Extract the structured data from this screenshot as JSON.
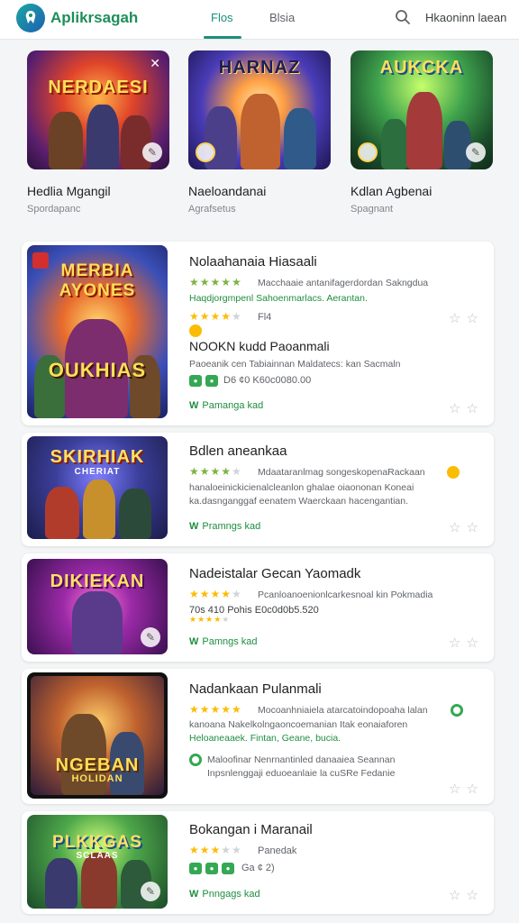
{
  "header": {
    "brand": "Aplikrsagah",
    "tabs": [
      "Flos",
      "Blsia"
    ],
    "active_tab": 0,
    "account": "Hkaoninn laean"
  },
  "icons": {
    "logo": "app-logo-icon",
    "search": "search-icon",
    "favorite": "star-outline-icon",
    "install": "check-badge-icon"
  },
  "colors": {
    "accent": "#1a8f7c",
    "brand": "#1e8e5a",
    "rating": "#7cb342"
  },
  "featured": [
    {
      "art_title": "NERDAESI",
      "name": "Hedlia Mgangil",
      "category": "Spordapanc"
    },
    {
      "art_title": "HARNAZ",
      "name": "Naeloandanai",
      "category": "Agrafsetus"
    },
    {
      "art_title": "AUKCKA",
      "name": "Kdlan Agbenai",
      "category": "Spagnant"
    }
  ],
  "list": [
    {
      "art_title": "MERBIA AYONES",
      "art_subtitle": "OUKHIAS",
      "title": "Nolaahanaia Hiasaali",
      "rating": 4,
      "desc1": "Macchaaie antanifagerdordan Sakngdua",
      "desc2": "Haqdjorgmpenl Sahoenmarlacs. Aerantan.",
      "rating2": 4,
      "rating_label": "Fl4",
      "subtitle2": "NOOKN kudd Paoanmali",
      "desc3": "Paoeanik cen Tabiainnan Maldatecs: kan Sacmaln",
      "chips_label": "D6 ¢0 K60c0080.00",
      "action": "Pamanga kad"
    },
    {
      "art_title": "SKIRHIAK",
      "art_subtitle": "CHERIAT",
      "title": "Bdlen aneankaa",
      "rating": 4,
      "desc1": "Mdaataranlmag songeskopenaRackaan",
      "desc2": "hanaloeinickicienalcleanlon ghalae oiaononan Koneai",
      "desc3": "ka.dasnganggaf eenatem Waerckaan hacengantian.",
      "action": "Pramngs kad"
    },
    {
      "art_title": "DIKIEKAN",
      "title": "Nadeistalar Gecan Yaomadk",
      "rating": 4,
      "desc1": "Pcanloanoenionlcarkesnoal kin Pokmadia",
      "sub_line": "70s 410 Pohis E0c0d0b5.520",
      "action": "Pamngs kad"
    },
    {
      "art_title": "NGEBAN",
      "art_subtitle": "HOLIDAN",
      "title": "Nadankaan Pulanmali",
      "rating": 5,
      "desc1": "Mocoanhniaiela atarcatoindopoaha lalan",
      "desc2": "kanoana Nakelkolngaoncoemanian Itak eonaiaforen",
      "desc3": "Heloaneaaek. Fintan, Geane, bucia.",
      "desc4": "Maloofinar Nenrnantinled danaaiea Seannan",
      "desc5": "Inpsnlenggaji eduoeanlaie la cuSRe Fedanie",
      "action": ""
    },
    {
      "art_title": "PLKKGAS",
      "art_subtitle": "SCLAAS",
      "title": "Bokangan i Maranail",
      "rating": 3,
      "rating_label": "Panedak",
      "chips_label": "Ga ¢ 2)",
      "action": "Pnngags kad"
    }
  ]
}
